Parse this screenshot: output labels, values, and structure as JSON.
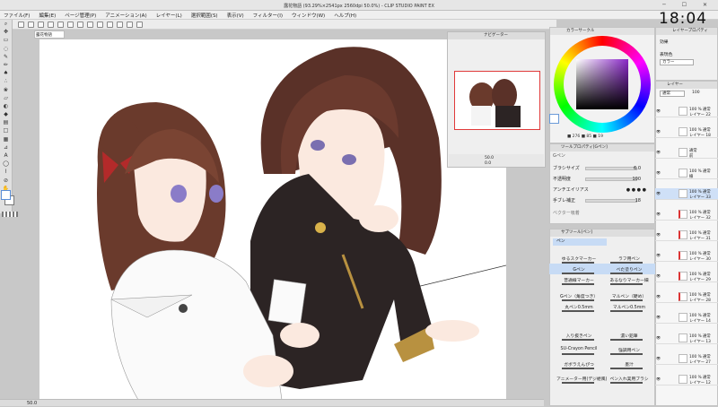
{
  "window": {
    "title": "露花物語 (93.29%×2541px 2560dpi 50.0%) - CLIP STUDIO PAINT EX",
    "clock": "18:04"
  },
  "menu": [
    "ファイル(F)",
    "編集(E)",
    "ページ管理(P)",
    "アニメーション(A)",
    "レイヤー(L)",
    "選択範囲(S)",
    "表示(V)",
    "フィルター(I)",
    "ウィンドウ(W)",
    "ヘルプ(H)"
  ],
  "canvas_tab": "露花物語",
  "navigator": {
    "title": "ナビゲーター",
    "zoom": "50.0",
    "angle": "0.0"
  },
  "color": {
    "title": "カラーサークル",
    "values": "■ 276 ■ 85 ■ 19"
  },
  "tool_property": {
    "title": "ツールプロパティ[Gペン]",
    "tool": "Gペン",
    "rows": [
      {
        "label": "ブラシサイズ",
        "value": "6.0"
      },
      {
        "label": "不透明度",
        "value": "100"
      },
      {
        "label": "アンチエイリアス",
        "value": ""
      },
      {
        "label": "手ブレ補正",
        "value": "18"
      },
      {
        "label": "ベクター吸着",
        "value": ""
      }
    ]
  },
  "brushes": {
    "title": "サブツール[ペン]",
    "group": "ペン",
    "rows": [
      {
        "left": "ゆるスクマーカー",
        "right": "ラフ用ペン"
      },
      {
        "left": "Gペン",
        "right": "べた塗りペン"
      },
      {
        "left": "普通線マーカー",
        "right": "あるなりマーカー細"
      },
      {
        "left": "Gペン（角度つき）",
        "right": "マルペン（硬め）"
      },
      {
        "left": "丸ペン0.5mm",
        "right": "マルペン0.5mm"
      },
      {
        "left": "入り抜きペン",
        "right": "濃い鉛筆"
      },
      {
        "left": "SU-Crayon Pencil",
        "right": "強調用ペン"
      },
      {
        "left": "ガボラえんぴつ",
        "right": "墨汁"
      },
      {
        "left": "アニメーター用(デジ絵風)",
        "right": "ペン入れ実用ブラシ"
      }
    ]
  },
  "layer_property": {
    "title": "レイヤープロパティ",
    "effect": "効果",
    "color_label": "表現色",
    "color_value": "カラー"
  },
  "layers": {
    "title": "レイヤー",
    "blend": "通常",
    "opacity": "100",
    "items": [
      {
        "top": "100 % 通常",
        "bottom": "レイヤー 22"
      },
      {
        "top": "100 % 通常",
        "bottom": "レイヤー 18"
      },
      {
        "top": "通常",
        "bottom": "前"
      },
      {
        "top": "100 % 通常",
        "bottom": "線"
      },
      {
        "top": "100 % 通常",
        "bottom": "レイヤー 33"
      },
      {
        "top": "100 % 通常",
        "bottom": "レイヤー 32"
      },
      {
        "top": "100 % 通常",
        "bottom": "レイヤー 31"
      },
      {
        "top": "100 % 通常",
        "bottom": "レイヤー 30"
      },
      {
        "top": "100 % 通常",
        "bottom": "レイヤー 29"
      },
      {
        "top": "100 % 通常",
        "bottom": "レイヤー 28"
      },
      {
        "top": "100 % 通常",
        "bottom": "レイヤー 14"
      },
      {
        "top": "100 % 通常",
        "bottom": "レイヤー 13"
      },
      {
        "top": "100 % 通常",
        "bottom": "レイヤー 27"
      },
      {
        "top": "100 % 通常",
        "bottom": "レイヤー 12"
      }
    ]
  },
  "status": {
    "zoom": "50.0"
  }
}
